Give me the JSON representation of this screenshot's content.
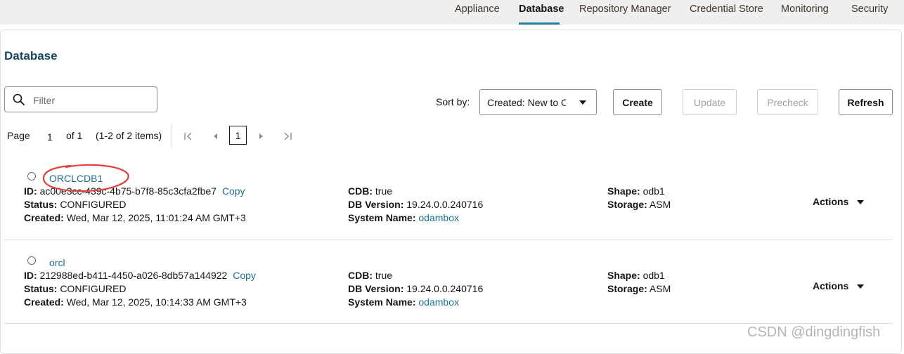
{
  "top_nav": {
    "items": [
      {
        "label": "Appliance",
        "active": false
      },
      {
        "label": "Database",
        "active": true
      },
      {
        "label": "Repository Manager",
        "active": false
      },
      {
        "label": "Credential Store",
        "active": false
      },
      {
        "label": "Monitoring",
        "active": false
      },
      {
        "label": "Security",
        "active": false
      }
    ],
    "accent_color": "#227e9e"
  },
  "page": {
    "title": "Database",
    "title_color": "#174660"
  },
  "toolbar": {
    "filter_placeholder": "Filter",
    "sort_label": "Sort by:",
    "sort_value": "Created: New to Old",
    "create_label": "Create",
    "update_label": "Update",
    "precheck_label": "Precheck",
    "refresh_label": "Refresh"
  },
  "pager": {
    "page_label": "Page",
    "page_number": "1",
    "of_label": "of 1",
    "items_label": "(1-2 of 2 items)",
    "current_page": "1"
  },
  "field_labels": {
    "id": "ID:",
    "status": "Status:",
    "created": "Created:",
    "cdb": "CDB:",
    "db_version": "DB Version:",
    "system_name": "System Name:",
    "shape": "Shape:",
    "storage": "Storage:",
    "copy": "Copy",
    "actions": "Actions"
  },
  "databases": [
    {
      "name": "ORCLCDB1",
      "id": "ac00e3cc-439c-4b75-b7f8-85c3cfa2fbe7",
      "status": "CONFIGURED",
      "created": "Wed, Mar 12, 2025, 11:01:24 AM GMT+3",
      "cdb": "true",
      "db_version": "19.24.0.0.240716",
      "system_name": "odambox",
      "shape": "odb1",
      "storage": "ASM",
      "highlighted": true
    },
    {
      "name": "orcl",
      "id": "212988ed-b411-4450-a026-8db57a144922",
      "status": "CONFIGURED",
      "created": "Wed, Mar 12, 2025, 10:14:33 AM GMT+3",
      "cdb": "true",
      "db_version": "19.24.0.0.240716",
      "system_name": "odambox",
      "shape": "odb1",
      "storage": "ASM",
      "highlighted": false
    }
  ],
  "watermark": "CSDN @dingdingfish",
  "annotation_color": "#e0403c"
}
